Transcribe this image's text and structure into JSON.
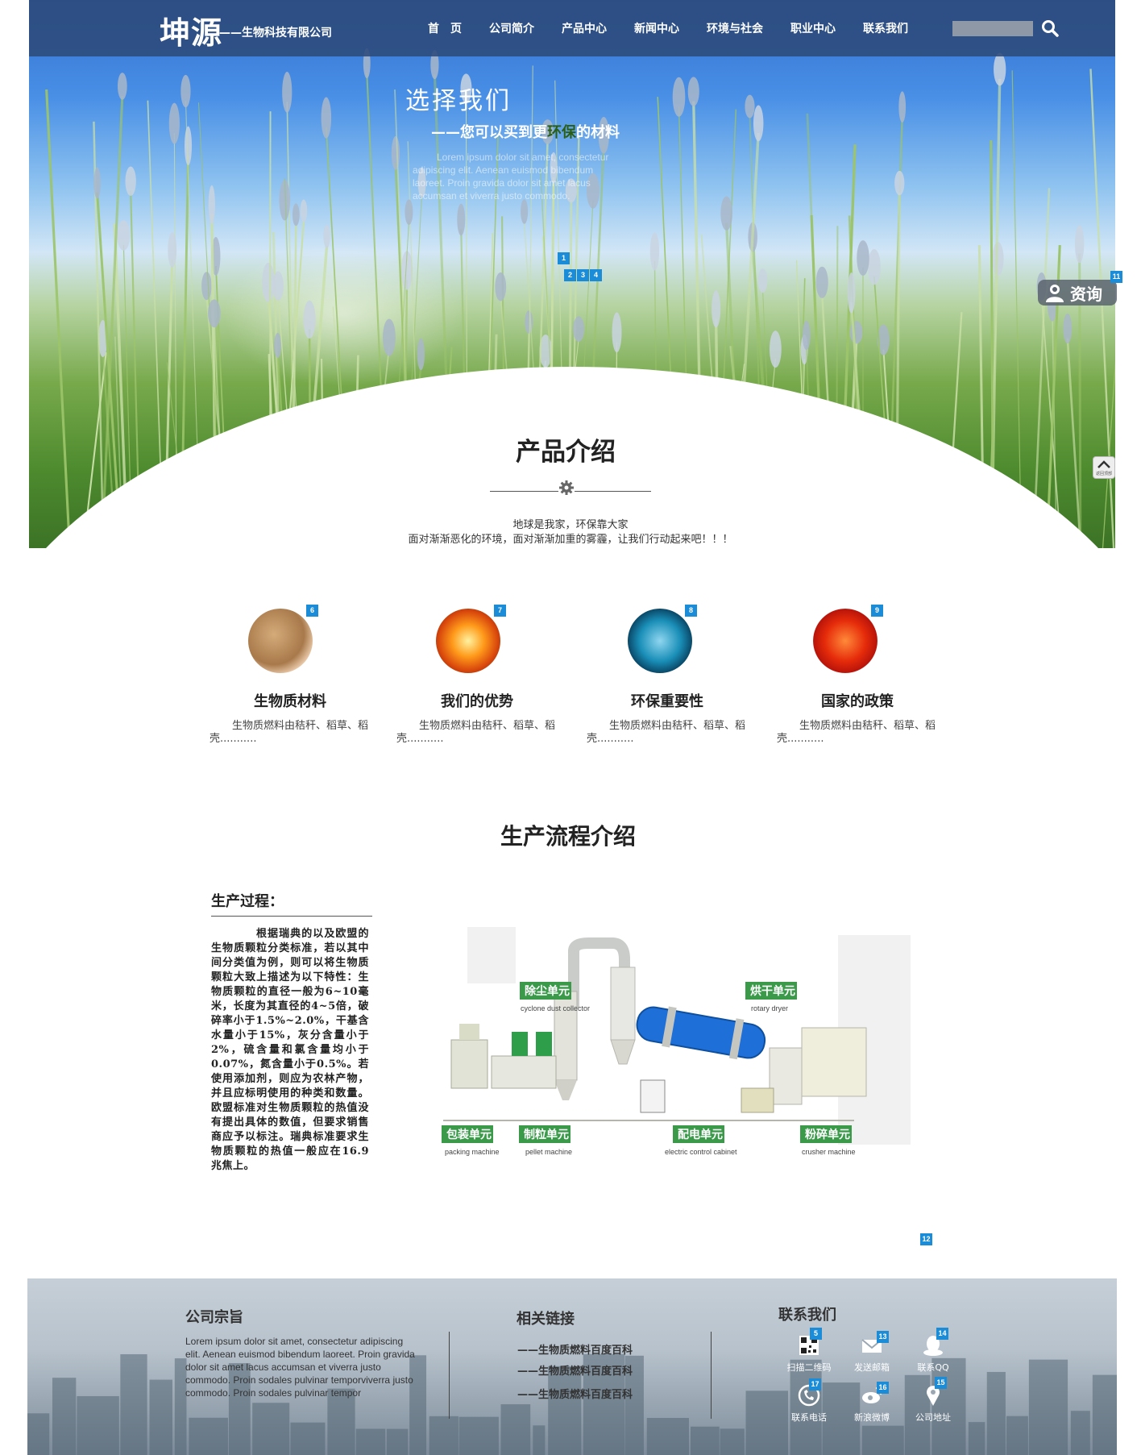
{
  "brand": {
    "name": "坤源",
    "subtitle": "——生物科技有限公司"
  },
  "nav": {
    "items": [
      "首　页",
      "公司简介",
      "产品中心",
      "新闻中心",
      "环境与社会",
      "职业中心",
      "联系我们"
    ],
    "search_value": ""
  },
  "hero": {
    "title": "选择我们",
    "subtitle_prefix": "——您可以买到更",
    "subtitle_highlight": "环保",
    "subtitle_suffix": "的材料",
    "lorem": "Lorem ipsum dolor sit amet, consectetur adipiscing elit. Aenean euismod bibendum laoreet. Proin gravida dolor sit amet lacus accumsan et viverra justo commodo.",
    "slides": [
      "1",
      "2",
      "3",
      "4"
    ]
  },
  "float": {
    "consult_label": "资询",
    "back_top_label": "返回顶部"
  },
  "badges": {
    "b1": "1",
    "b2": "2",
    "b3": "3",
    "b4": "4",
    "b5": "5",
    "b6": "6",
    "b7": "7",
    "b8": "8",
    "b9": "9",
    "b11": "11",
    "b12": "12",
    "b13": "13",
    "b14": "14",
    "b15": "15",
    "b16": "16",
    "b17": "17"
  },
  "products": {
    "title": "产品介绍",
    "intro_line1": "地球是我家，环保靠大家",
    "intro_line2": "面对渐渐恶化的环境，面对渐渐加重的雾霾，让我们行动起来吧！！！",
    "cards": [
      {
        "title": "生物质材料",
        "desc": "生物质燃料由秸秆、稻草、稻壳..........."
      },
      {
        "title": "我们的优势",
        "desc": "生物质燃料由秸秆、稻草、稻壳..........."
      },
      {
        "title": "环保重要性",
        "desc": "生物质燃料由秸秆、稻草、稻壳..........."
      },
      {
        "title": "国家的政策",
        "desc": "生物质燃料由秸秆、稻草、稻壳..........."
      }
    ]
  },
  "process": {
    "title": "生产流程介绍",
    "label": "生产过程：",
    "text": "根据瑞典的以及欧盟的生物质颗粒分类标准，若以其中间分类值为例，则可以将生物质颗粒大致上描述为以下特性：生物质颗粒的直径一般为6~10毫米，长度为其直径的4~5倍，破碎率小于1.5%~2.0%，干基含水量小于15%，灰分含量小于2%，硫含量和氯含量均小于0.07%，氮含量小于0.5%。若使用添加剂，则应为农林产物，并且应标明使用的种类和数量。欧盟标准对生物质颗粒的热值没有提出具体的数值，但要求销售商应予以标注。瑞典标准要求生物质颗粒的热值一般应在16.9 兆焦上。",
    "machine_units": [
      {
        "cn": "除尘单元",
        "en": "cyclone dust collector"
      },
      {
        "cn": "烘干单元",
        "en": "rotary dryer"
      },
      {
        "cn": "包装单元",
        "en": "packing machine"
      },
      {
        "cn": "制粒单元",
        "en": "pellet machine"
      },
      {
        "cn": "配电单元",
        "en": "electric control cabinet"
      },
      {
        "cn": "粉碎单元",
        "en": "crusher machine"
      }
    ]
  },
  "footer": {
    "mission_title": "公司宗旨",
    "mission_text": "Lorem ipsum dolor sit amet, consectetur adipiscing elit. Aenean euismod bibendum laoreet. Proin gravida dolor sit amet lacus accumsan et viverra justo commodo. Proin sodales pulvinar temporviverra justo commodo. Proin sodales pulvinar tempor",
    "links_title": "相关链接",
    "links": [
      "——生物质燃料百度百科",
      "——生物质燃料百度百科",
      "——生物质燃料百度百科"
    ],
    "contact_title": "联系我们",
    "contacts": [
      "扫描二维码",
      "发送邮箱",
      "联系QQ",
      "联系电话",
      "新浪微博",
      "公司地址"
    ]
  },
  "colors": {
    "nav_bg": "#2c4a7a",
    "badge": "#1a8cd8",
    "eco_green": "#2a5e13"
  }
}
